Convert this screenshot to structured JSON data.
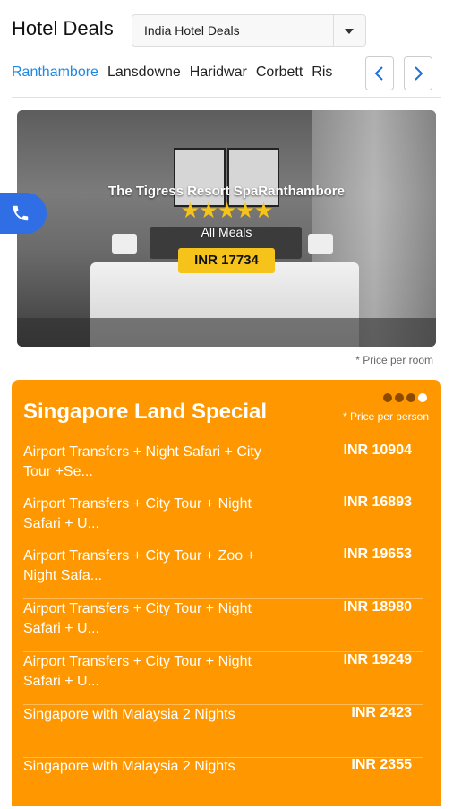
{
  "header": {
    "title": "Hotel Deals",
    "dropdown_value": "India Hotel Deals"
  },
  "tabs": [
    "Ranthambore",
    "Lansdowne",
    "Haridwar",
    "Corbett",
    "Ris"
  ],
  "nav": {
    "prev_icon": "chevron-left-icon",
    "next_icon": "chevron-right-icon"
  },
  "hero": {
    "hotel_name": "The Tigress Resort SpaRanthambore",
    "stars": "★★★★★",
    "rating": 5,
    "meals": "All Meals",
    "price": "INR 17734",
    "price_note": "* Price per room"
  },
  "floating": {
    "icon": "phone-icon"
  },
  "deal_card": {
    "title": "Singapore Land Special",
    "price_note": "* Price per person",
    "pager": {
      "pages": 4,
      "current": 4
    },
    "items": [
      {
        "desc": "Airport Transfers + Night Safari + City Tour +Se...",
        "price": "INR 10904"
      },
      {
        "desc": "Airport Transfers + City Tour + Night Safari + U...",
        "price": "INR 16893"
      },
      {
        "desc": "Airport Transfers + City Tour + Zoo + Night Safa...",
        "price": "INR 19653"
      },
      {
        "desc": "Airport Transfers + City Tour + Night Safari + U...",
        "price": "INR 18980"
      },
      {
        "desc": "Airport Transfers + City Tour + Night Safari + U...",
        "price": "INR 19249"
      },
      {
        "desc": "Singapore with Malaysia 2 Nights",
        "price": "INR 2423"
      },
      {
        "desc": "Singapore with Malaysia 2 Nights",
        "price": "INR 2355"
      }
    ]
  },
  "colors": {
    "accent": "#1e88e5",
    "card": "#ff9800",
    "badge": "#f6c31b",
    "phone": "#2f6ee5"
  }
}
